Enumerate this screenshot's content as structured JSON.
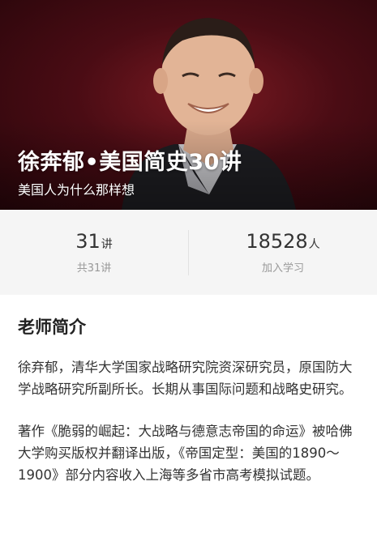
{
  "header": {
    "title": "徐奔郁•美国简史30讲",
    "subtitle": "美国人为什么那样想"
  },
  "stats": {
    "lectures": {
      "number": "31",
      "unit": "讲",
      "label": "共31讲"
    },
    "learners": {
      "number": "18528",
      "unit": "人",
      "label": "加入学习"
    }
  },
  "intro": {
    "heading": "老师简介",
    "paragraphs": [
      "徐弃郁，清华大学国家战略研究院资深研究员，原国防大学战略研究所副所长。长期从事国际问题和战略史研究。",
      "著作《脆弱的崛起：大战略与德意志帝国的命运》被哈佛大学购买版权并翻译出版，《帝国定型：美国的1890～1900》部分内容收入上海等多省市高考模拟试题。"
    ]
  }
}
